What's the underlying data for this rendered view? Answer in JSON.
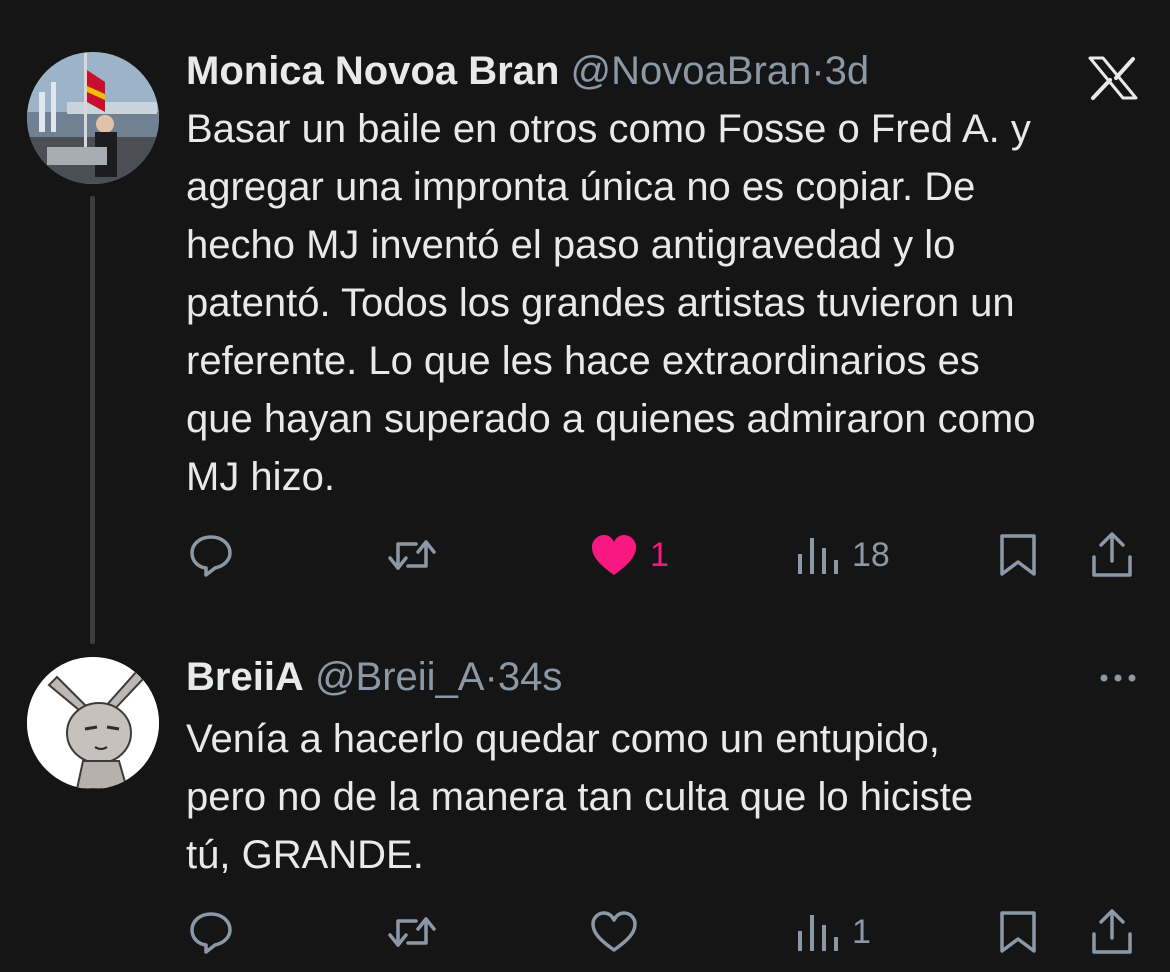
{
  "tweets": [
    {
      "author_name": "Monica Novoa Bran",
      "handle": "@NovoaBran",
      "separator": "·",
      "time": "3d",
      "text": "Basar un baile en otros como Fosse o Fred A. y\nagregar una impronta única no es copiar. De\nhecho MJ inventó el paso antigravedad y lo\npatentó. Todos los grandes artistas tuvieron un\nreferente. Lo que les hace extraordinarios es\nque hayan superado a quienes admiraron como\nMJ hizo.",
      "like_count": "1",
      "liked": true,
      "view_count": "18"
    },
    {
      "author_name": "BreiiA",
      "handle": "@Breii_A",
      "separator": "·",
      "time": "34s",
      "text": "Venía a hacerlo quedar como un entupido,\npero no de la manera tan culta que lo hiciste\ntú, GRANDE.",
      "like_count": "",
      "liked": false,
      "view_count": "1"
    }
  ],
  "colors": {
    "background": "#151516",
    "text": "#e7e9ea",
    "secondary": "#8b98a5",
    "like_active": "#f91880"
  },
  "icons": [
    "x-logo-icon",
    "reply-icon",
    "retweet-icon",
    "heart-icon",
    "views-icon",
    "bookmark-icon",
    "share-icon",
    "more-icon"
  ]
}
